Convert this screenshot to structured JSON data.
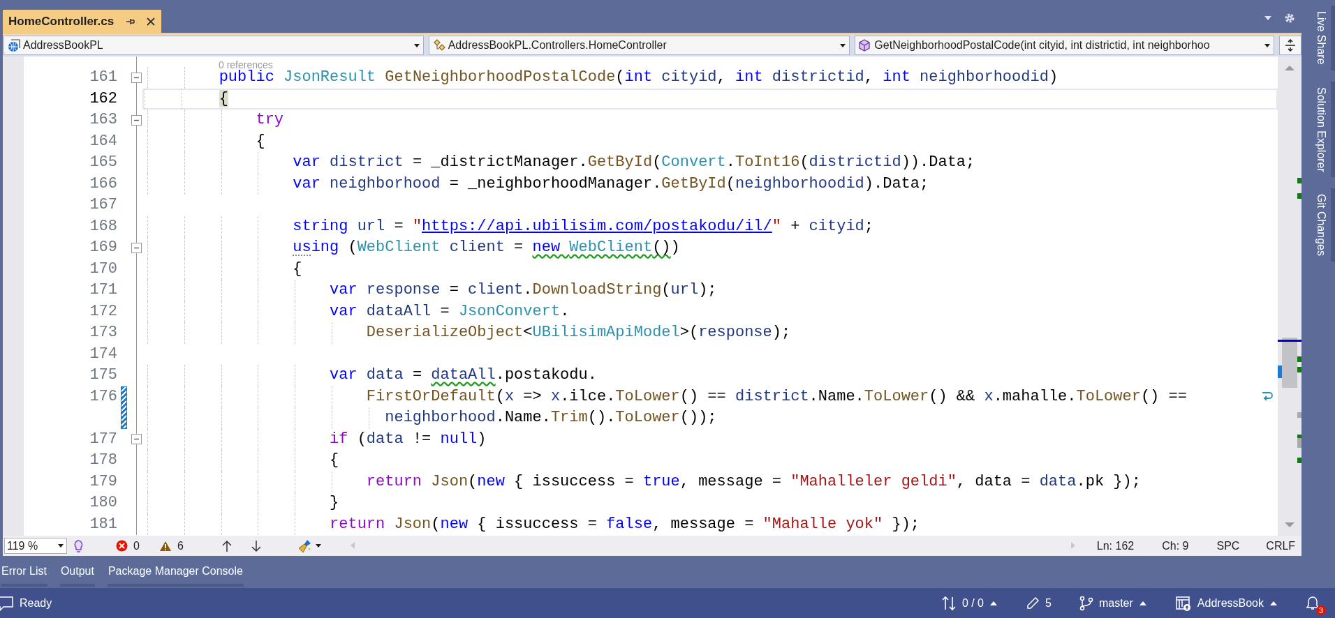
{
  "file_tab": {
    "label": "HomeController.cs",
    "selected": true
  },
  "navigation": {
    "project": "AddressBookPL",
    "type": "AddressBookPL.Controllers.HomeController",
    "member": "GetNeighborhoodPostalCode(int cityid, int districtid, int neighborhoo"
  },
  "codelens": "0 references",
  "lines": [
    {
      "number": "161",
      "current": false,
      "foldable": true,
      "changed": false,
      "tokens": [
        {
          "kind": "keyword",
          "text": "        public "
        },
        {
          "kind": "type",
          "text": "JsonResult "
        },
        {
          "kind": "method",
          "text": "GetNeighborhoodPostalCode"
        },
        {
          "kind": "plain",
          "text": "("
        },
        {
          "kind": "keyword",
          "text": "int "
        },
        {
          "kind": "variable",
          "text": "cityid"
        },
        {
          "kind": "plain",
          "text": ", "
        },
        {
          "kind": "keyword",
          "text": "int "
        },
        {
          "kind": "variable",
          "text": "districtid"
        },
        {
          "kind": "plain",
          "text": ", "
        },
        {
          "kind": "keyword",
          "text": "int "
        },
        {
          "kind": "variable",
          "text": "neighborhoodid"
        },
        {
          "kind": "plain",
          "text": ")"
        }
      ]
    },
    {
      "number": "162",
      "current": true,
      "foldable": false,
      "changed": false,
      "tokens": [
        {
          "kind": "plain",
          "text": "        {",
          "matched": true
        }
      ]
    },
    {
      "number": "163",
      "current": false,
      "foldable": true,
      "changed": false,
      "tokens": [
        {
          "kind": "control",
          "text": "            try"
        }
      ]
    },
    {
      "number": "164",
      "current": false,
      "foldable": false,
      "changed": false,
      "tokens": [
        {
          "kind": "plain",
          "text": "            {"
        }
      ]
    },
    {
      "number": "165",
      "current": false,
      "foldable": false,
      "changed": false,
      "tokens": [
        {
          "kind": "keyword",
          "text": "                var "
        },
        {
          "kind": "variable",
          "text": "district"
        },
        {
          "kind": "plain",
          "text": " = _districtManager."
        },
        {
          "kind": "method",
          "text": "GetById"
        },
        {
          "kind": "plain",
          "text": "("
        },
        {
          "kind": "type",
          "text": "Convert"
        },
        {
          "kind": "plain",
          "text": "."
        },
        {
          "kind": "method",
          "text": "ToInt16"
        },
        {
          "kind": "plain",
          "text": "("
        },
        {
          "kind": "variable",
          "text": "districtid"
        },
        {
          "kind": "plain",
          "text": ")).Data;"
        }
      ]
    },
    {
      "number": "166",
      "current": false,
      "foldable": false,
      "changed": false,
      "tokens": [
        {
          "kind": "keyword",
          "text": "                var "
        },
        {
          "kind": "variable",
          "text": "neighborhood"
        },
        {
          "kind": "plain",
          "text": " = _neighborhoodManager."
        },
        {
          "kind": "method",
          "text": "GetById"
        },
        {
          "kind": "plain",
          "text": "("
        },
        {
          "kind": "variable",
          "text": "neighborhoodid"
        },
        {
          "kind": "plain",
          "text": ").Data;"
        }
      ]
    },
    {
      "number": "167",
      "current": false,
      "foldable": false,
      "changed": false
    },
    {
      "number": "168",
      "current": false,
      "foldable": false,
      "changed": false,
      "tokens": [
        {
          "kind": "keyword",
          "text": "                string "
        },
        {
          "kind": "variable",
          "text": "url"
        },
        {
          "kind": "plain",
          "text": " = "
        },
        {
          "kind": "string",
          "text": "\""
        },
        {
          "kind": "link",
          "text": "https://api.ubilisim.com/postakodu/il/"
        },
        {
          "kind": "string",
          "text": "\""
        },
        {
          "kind": "plain",
          "text": " + "
        },
        {
          "kind": "variable",
          "text": "cityid"
        },
        {
          "kind": "plain",
          "text": ";"
        }
      ]
    },
    {
      "number": "169",
      "current": false,
      "foldable": true,
      "changed": false,
      "tokens": [
        {
          "kind": "keyword",
          "text": "                us",
          "suggestion": true
        },
        {
          "kind": "keyword",
          "text": "ing "
        },
        {
          "kind": "plain",
          "text": "("
        },
        {
          "kind": "type",
          "text": "WebClient "
        },
        {
          "kind": "variable",
          "text": "client"
        },
        {
          "kind": "plain",
          "text": " = "
        },
        {
          "kind": "keyword",
          "text": "new ",
          "warning": true
        },
        {
          "kind": "type",
          "text": "WebClient",
          "warning": true
        },
        {
          "kind": "plain",
          "text": "()",
          "warning": true
        },
        {
          "kind": "plain",
          "text": ")"
        }
      ]
    },
    {
      "number": "170",
      "current": false,
      "foldable": false,
      "changed": false,
      "tokens": [
        {
          "kind": "plain",
          "text": "                {"
        }
      ]
    },
    {
      "number": "171",
      "current": false,
      "foldable": false,
      "changed": false,
      "tokens": [
        {
          "kind": "keyword",
          "text": "                    var "
        },
        {
          "kind": "variable",
          "text": "response"
        },
        {
          "kind": "plain",
          "text": " = "
        },
        {
          "kind": "variable",
          "text": "client"
        },
        {
          "kind": "plain",
          "text": "."
        },
        {
          "kind": "method",
          "text": "DownloadString"
        },
        {
          "kind": "plain",
          "text": "("
        },
        {
          "kind": "variable",
          "text": "url"
        },
        {
          "kind": "plain",
          "text": ");"
        }
      ]
    },
    {
      "number": "172",
      "current": false,
      "foldable": false,
      "changed": false,
      "tokens": [
        {
          "kind": "keyword",
          "text": "                    var "
        },
        {
          "kind": "variable",
          "text": "dataAll"
        },
        {
          "kind": "plain",
          "text": " = "
        },
        {
          "kind": "type",
          "text": "JsonConvert"
        },
        {
          "kind": "plain",
          "text": "."
        }
      ]
    },
    {
      "number": "173",
      "current": false,
      "foldable": false,
      "changed": false,
      "tokens": [
        {
          "kind": "method",
          "text": "                        DeserializeObject"
        },
        {
          "kind": "plain",
          "text": "<"
        },
        {
          "kind": "type",
          "text": "UBilisimApiModel"
        },
        {
          "kind": "plain",
          "text": ">("
        },
        {
          "kind": "variable",
          "text": "response"
        },
        {
          "kind": "plain",
          "text": ");"
        }
      ]
    },
    {
      "number": "174",
      "current": false,
      "foldable": false,
      "changed": false
    },
    {
      "number": "175",
      "current": false,
      "foldable": false,
      "changed": false,
      "tokens": [
        {
          "kind": "keyword",
          "text": "                    var "
        },
        {
          "kind": "variable",
          "text": "data"
        },
        {
          "kind": "plain",
          "text": " = "
        },
        {
          "kind": "variable",
          "text": "dataAll",
          "warning": true
        },
        {
          "kind": "plain",
          "text": ".postakodu."
        }
      ]
    },
    {
      "number": "176",
      "current": false,
      "foldable": false,
      "changed": true,
      "tokens": [
        {
          "kind": "method",
          "text": "                        FirstOrDefault"
        },
        {
          "kind": "plain",
          "text": "("
        },
        {
          "kind": "variable",
          "text": "x"
        },
        {
          "kind": "plain",
          "text": " => "
        },
        {
          "kind": "variable",
          "text": "x"
        },
        {
          "kind": "plain",
          "text": ".ilce."
        },
        {
          "kind": "method",
          "text": "ToLower"
        },
        {
          "kind": "plain",
          "text": "() == "
        },
        {
          "kind": "variable",
          "text": "district"
        },
        {
          "kind": "plain",
          "text": ".Name."
        },
        {
          "kind": "method",
          "text": "ToLower"
        },
        {
          "kind": "plain",
          "text": "() && "
        },
        {
          "kind": "variable",
          "text": "x"
        },
        {
          "kind": "plain",
          "text": ".mahalle."
        },
        {
          "kind": "method",
          "text": "ToLower"
        },
        {
          "kind": "plain",
          "text": "() =="
        }
      ],
      "wrap": [
        {
          "kind": "variable",
          "text": "                          neighborhood"
        },
        {
          "kind": "plain",
          "text": ".Name."
        },
        {
          "kind": "method",
          "text": "Trim"
        },
        {
          "kind": "plain",
          "text": "()."
        },
        {
          "kind": "method",
          "text": "ToLower"
        },
        {
          "kind": "plain",
          "text": "());"
        }
      ]
    },
    {
      "number": "177",
      "current": false,
      "foldable": true,
      "changed": false,
      "tokens": [
        {
          "kind": "control",
          "text": "                    if"
        },
        {
          "kind": "plain",
          "text": " ("
        },
        {
          "kind": "variable",
          "text": "data"
        },
        {
          "kind": "plain",
          "text": " != "
        },
        {
          "kind": "keyword",
          "text": "null"
        },
        {
          "kind": "plain",
          "text": ")"
        }
      ]
    },
    {
      "number": "178",
      "current": false,
      "foldable": false,
      "changed": false,
      "tokens": [
        {
          "kind": "plain",
          "text": "                    {"
        }
      ]
    },
    {
      "number": "179",
      "current": false,
      "foldable": false,
      "changed": false,
      "tokens": [
        {
          "kind": "control",
          "text": "                        return "
        },
        {
          "kind": "method",
          "text": "Json"
        },
        {
          "kind": "plain",
          "text": "("
        },
        {
          "kind": "keyword",
          "text": "new"
        },
        {
          "kind": "plain",
          "text": " { issuccess = "
        },
        {
          "kind": "keyword",
          "text": "true"
        },
        {
          "kind": "plain",
          "text": ", message = "
        },
        {
          "kind": "string",
          "text": "\"Mahalleler geldi\""
        },
        {
          "kind": "plain",
          "text": ", data = "
        },
        {
          "kind": "variable",
          "text": "data"
        },
        {
          "kind": "plain",
          "text": ".pk });"
        }
      ]
    },
    {
      "number": "180",
      "current": false,
      "foldable": false,
      "changed": false,
      "tokens": [
        {
          "kind": "plain",
          "text": "                    }"
        }
      ]
    },
    {
      "number": "181",
      "current": false,
      "foldable": false,
      "changed": false,
      "tokens": [
        {
          "kind": "control",
          "text": "                    return "
        },
        {
          "kind": "method",
          "text": "Json"
        },
        {
          "kind": "plain",
          "text": "("
        },
        {
          "kind": "keyword",
          "text": "new"
        },
        {
          "kind": "plain",
          "text": " { issuccess = "
        },
        {
          "kind": "keyword",
          "text": "false"
        },
        {
          "kind": "plain",
          "text": ", message = "
        },
        {
          "kind": "string",
          "text": "\"Mahalle yok\""
        },
        {
          "kind": "plain",
          "text": " });"
        }
      ]
    }
  ],
  "editor_status": {
    "zoom": "119 %",
    "errors": "0",
    "warnings": "6",
    "line": "Ln: 162",
    "column": "Ch: 9",
    "indent": "SPC",
    "line_ending": "CRLF"
  },
  "tool_tabs": [
    {
      "label": "Error List",
      "selected": false
    },
    {
      "label": "Output",
      "selected": false
    },
    {
      "label": "Package Manager Console",
      "selected": false
    }
  ],
  "side_tabs": [
    "Live Share",
    "Solution Explorer",
    "Git Changes"
  ],
  "status_bar": {
    "message": "Ready",
    "sync": "0 / 0",
    "changes": "5",
    "branch": "master",
    "repository": "AddressBook",
    "notifications": "3"
  }
}
